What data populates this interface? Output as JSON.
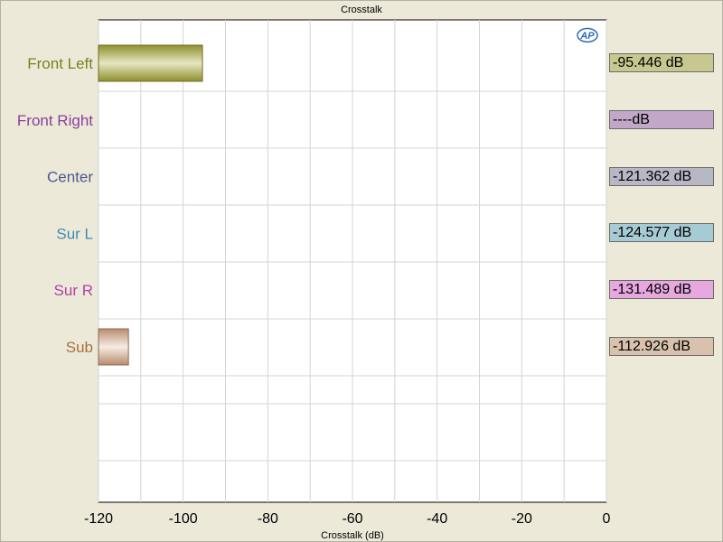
{
  "chart_data": {
    "type": "bar",
    "orientation": "horizontal",
    "title": "Crosstalk",
    "xlabel": "Crosstalk (dB)",
    "xlim": [
      -120,
      0
    ],
    "xticks": [
      -120,
      -100,
      -80,
      -60,
      -40,
      -20,
      0
    ],
    "grid": true,
    "categories": [
      "Front Left",
      "Front Right",
      "Center",
      "Sur L",
      "Sur R",
      "Sub"
    ],
    "values": [
      -95.446,
      null,
      -121.362,
      -124.577,
      -131.489,
      -112.926
    ],
    "readouts": [
      "-95.446 dB",
      "----dB",
      "-121.362 dB",
      "-124.577 dB",
      "-131.489 dB",
      "-112.926 dB"
    ],
    "label_colors": [
      "#7f7f1f",
      "#8a3f9c",
      "#4f5790",
      "#3f8bb0",
      "#b33fa8",
      "#a8703f"
    ],
    "readout_colors": [
      "#c7c78f",
      "#c3a7c9",
      "#b7b7c5",
      "#a7cbd5",
      "#e7a7df",
      "#d9c2ad"
    ],
    "bar_colors": [
      "#a8a84a",
      "#c3a7c9",
      "#b7b7c5",
      "#a7cbd5",
      "#e7a7df",
      "#d4ad95"
    ]
  },
  "icons": {
    "logo": "ap-logo-icon"
  }
}
